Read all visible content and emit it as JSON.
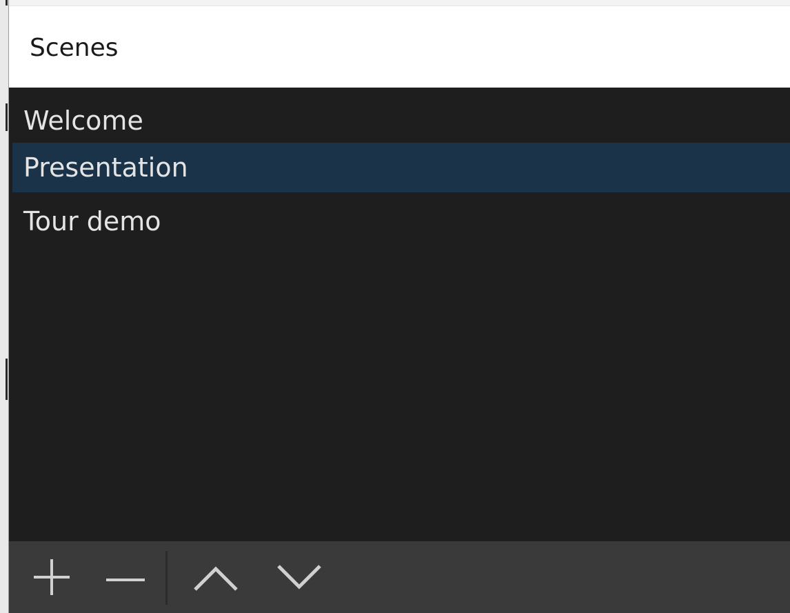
{
  "dock": {
    "title": "Scenes"
  },
  "scenes": {
    "items": [
      {
        "label": "Welcome"
      },
      {
        "label": "Presentation",
        "selected": true
      },
      {
        "label": "Tour demo"
      }
    ]
  },
  "toolbar": {
    "buttons": [
      {
        "name": "add-scene-button",
        "icon": "plus-icon"
      },
      {
        "name": "remove-scene-button",
        "icon": "minus-icon"
      },
      {
        "name": "move-scene-up-button",
        "icon": "chevron-up-icon"
      },
      {
        "name": "move-scene-down-button",
        "icon": "chevron-down-icon"
      }
    ]
  },
  "colors": {
    "list_background": "#1e1e1e",
    "selected_background": "#1b3348",
    "toolbar_background": "#3a3a3a",
    "icon_color": "#d0d0d0",
    "text_color": "#e4e4e4"
  }
}
